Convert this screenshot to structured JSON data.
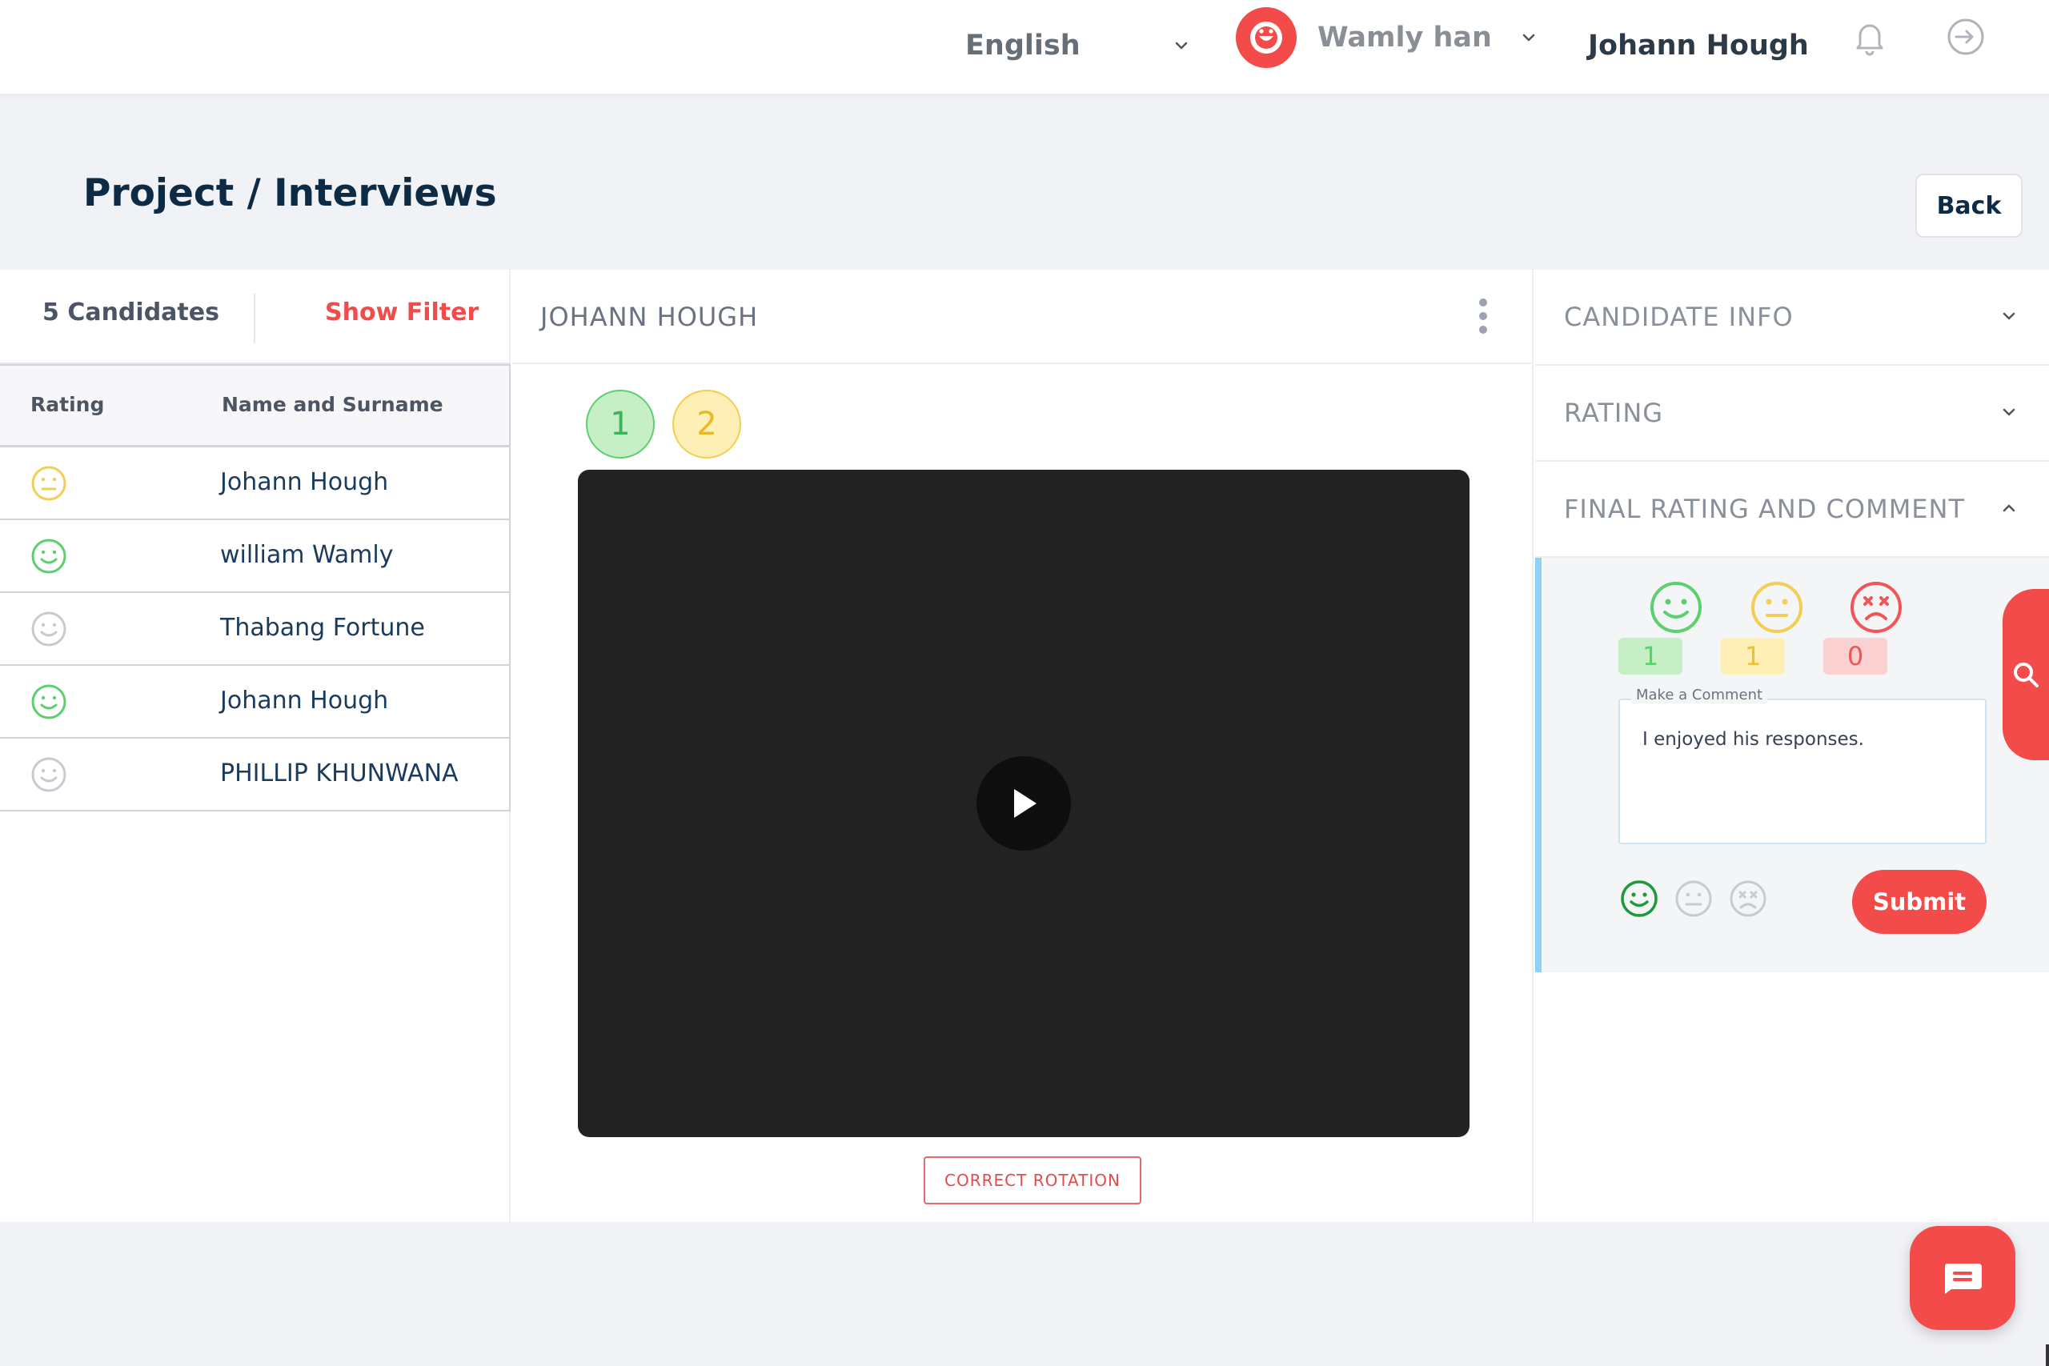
{
  "topbar": {
    "language": "English",
    "company": "Wamly han",
    "user_name": "Johann Hough",
    "icons": [
      "chevron-down-icon",
      "brand-logo-icon",
      "bell-icon",
      "logout-icon"
    ]
  },
  "page": {
    "title": "Project / Interviews",
    "back_label": "Back"
  },
  "candidates": {
    "count_label": "5 Candidates",
    "filter_label": "Show Filter",
    "columns": [
      "Rating",
      "Name and Surname"
    ],
    "rows": [
      {
        "name": "Johann Hough",
        "rating": "neutral"
      },
      {
        "name": "william Wamly",
        "rating": "positive"
      },
      {
        "name": "Thabang Fortune",
        "rating": "none"
      },
      {
        "name": "Johann Hough",
        "rating": "positive"
      },
      {
        "name": "PHILLIP KHUNWANA",
        "rating": "none"
      }
    ]
  },
  "viewer": {
    "candidate_name": "JOHANN HOUGH",
    "questions": [
      "1",
      "2"
    ],
    "rotate_label": "CORRECT ROTATION"
  },
  "side": {
    "candidate_info": "CANDIDATE INFO",
    "rating": "RATING",
    "final": "FINAL RATING AND COMMENT",
    "counts": {
      "positive": "1",
      "neutral": "1",
      "negative": "0"
    },
    "comment_label": "Make a Comment",
    "comment_text": "I enjoyed his responses.",
    "selected_rating": "positive",
    "submit_label": "Submit"
  },
  "colors": {
    "brand": "#f34a4a",
    "positive": "#5ccf6e",
    "neutral": "#f2cf52",
    "negative": "#f05656",
    "none": "#c7cbd1",
    "heading": "#0d2b45"
  }
}
